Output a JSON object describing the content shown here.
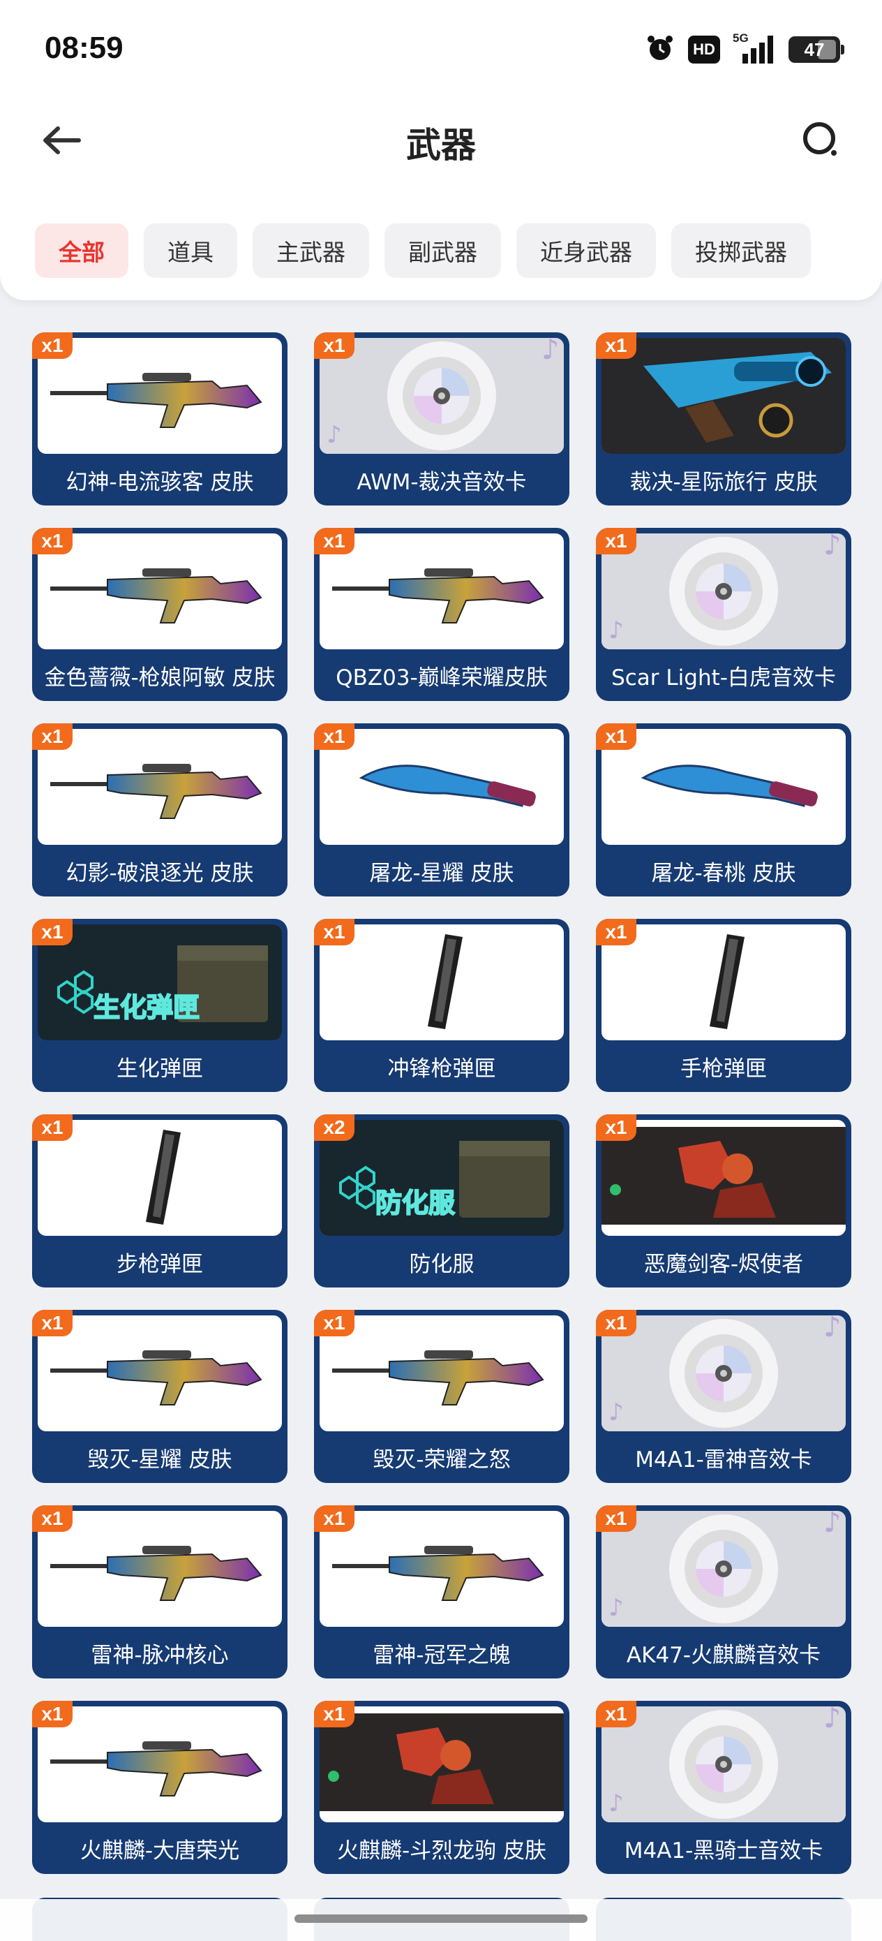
{
  "status_bar": {
    "time": "08:59",
    "hd": "HD",
    "network": "5G",
    "battery": "47"
  },
  "header": {
    "title": "武器",
    "back_icon": "back-arrow-icon",
    "search_icon": "search-icon"
  },
  "tabs": [
    {
      "label": "全部",
      "active": true
    },
    {
      "label": "道具",
      "active": false
    },
    {
      "label": "主武器",
      "active": false
    },
    {
      "label": "副武器",
      "active": false
    },
    {
      "label": "近身武器",
      "active": false
    },
    {
      "label": "投掷武器",
      "active": false
    }
  ],
  "colors": {
    "card_bg": "#163a72",
    "badge": "#f26a1b",
    "active_tab_text": "#e8352f",
    "active_tab_bg": "#fde6e6"
  },
  "items": [
    {
      "qty": "x1",
      "name": "幻神-电流骇客 皮肤",
      "thumb": "rifle"
    },
    {
      "qty": "x1",
      "name": "AWM-裁决音效卡",
      "thumb": "disc"
    },
    {
      "qty": "x1",
      "name": "裁决-星际旅行 皮肤",
      "thumb": "scope"
    },
    {
      "qty": "x1",
      "name": "金色蔷薇-枪娘阿敏 皮肤",
      "thumb": "rifle"
    },
    {
      "qty": "x1",
      "name": "QBZ03-巅峰荣耀皮肤",
      "thumb": "rifle"
    },
    {
      "qty": "x1",
      "name": "Scar Light-白虎音效卡",
      "thumb": "disc"
    },
    {
      "qty": "x1",
      "name": "幻影-破浪逐光 皮肤",
      "thumb": "rifle"
    },
    {
      "qty": "x1",
      "name": "屠龙-星耀 皮肤",
      "thumb": "knife"
    },
    {
      "qty": "x1",
      "name": "屠龙-春桃 皮肤",
      "thumb": "knife"
    },
    {
      "qty": "x1",
      "name": "生化弹匣",
      "thumb": "box",
      "thumb_text": "生化弹匣"
    },
    {
      "qty": "x1",
      "name": "冲锋枪弹匣",
      "thumb": "mag"
    },
    {
      "qty": "x1",
      "name": "手枪弹匣",
      "thumb": "mag"
    },
    {
      "qty": "x1",
      "name": "步枪弹匣",
      "thumb": "mag"
    },
    {
      "qty": "x2",
      "name": "防化服",
      "thumb": "box",
      "thumb_text": "防化服"
    },
    {
      "qty": "x1",
      "name": "恶魔剑客-烬使者",
      "thumb": "banner"
    },
    {
      "qty": "x1",
      "name": "毁灭-星耀 皮肤",
      "thumb": "rifle"
    },
    {
      "qty": "x1",
      "name": "毁灭-荣耀之怒",
      "thumb": "rifle"
    },
    {
      "qty": "x1",
      "name": "M4A1-雷神音效卡",
      "thumb": "disc"
    },
    {
      "qty": "x1",
      "name": "雷神-脉冲核心",
      "thumb": "rifle"
    },
    {
      "qty": "x1",
      "name": "雷神-冠军之魄",
      "thumb": "rifle"
    },
    {
      "qty": "x1",
      "name": "AK47-火麒麟音效卡",
      "thumb": "disc"
    },
    {
      "qty": "x1",
      "name": "火麒麟-大唐荣光",
      "thumb": "rifle"
    },
    {
      "qty": "x1",
      "name": "火麒麟-斗烈龙驹 皮肤",
      "thumb": "banner"
    },
    {
      "qty": "x1",
      "name": "M4A1-黑骑士音效卡",
      "thumb": "disc"
    }
  ]
}
